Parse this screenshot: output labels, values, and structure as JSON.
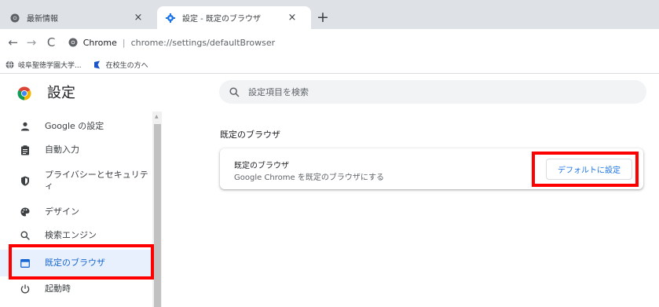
{
  "browser": {
    "tabs": [
      {
        "title": "最新情報",
        "icon": "chrome-icon",
        "close": "×"
      },
      {
        "title": "設定 - 既定のブラウザ",
        "icon": "gear-icon",
        "close": "×"
      }
    ],
    "new_tab": "+",
    "nav": {
      "back": "←",
      "forward": "→",
      "reload": "C"
    },
    "omnibox": {
      "site": "Chrome",
      "separator": "|",
      "url": "chrome://settings/defaultBrowser"
    },
    "bookmarks": [
      {
        "label": "岐阜聖徳学園大学...",
        "icon": "globe-icon"
      },
      {
        "label": "在校生の方へ",
        "icon": "bookmark-favicon-icon"
      }
    ]
  },
  "settings": {
    "title": "設定",
    "search_placeholder": "設定項目を検索",
    "nav_items": [
      {
        "label": "Google の設定",
        "icon": "person-icon"
      },
      {
        "label": "自動入力",
        "icon": "clipboard-icon"
      },
      {
        "label": "プライバシーとセキュリティ",
        "icon": "shield-icon"
      },
      {
        "label": "デザイン",
        "icon": "palette-icon"
      },
      {
        "label": "検索エンジン",
        "icon": "search-icon"
      },
      {
        "label": "既定のブラウザ",
        "icon": "browser-icon",
        "selected": true
      },
      {
        "label": "起動時",
        "icon": "power-icon"
      }
    ],
    "section_title": "既定のブラウザ",
    "card": {
      "title": "既定のブラウザ",
      "subtitle": "Google Chrome を既定のブラウザにする",
      "button": "デフォルトに設定"
    }
  },
  "colors": {
    "accent": "#1a73e8",
    "selected_bg": "#e8f0fe",
    "highlight": "#ff0000",
    "tabstrip": "#dee1e6"
  }
}
